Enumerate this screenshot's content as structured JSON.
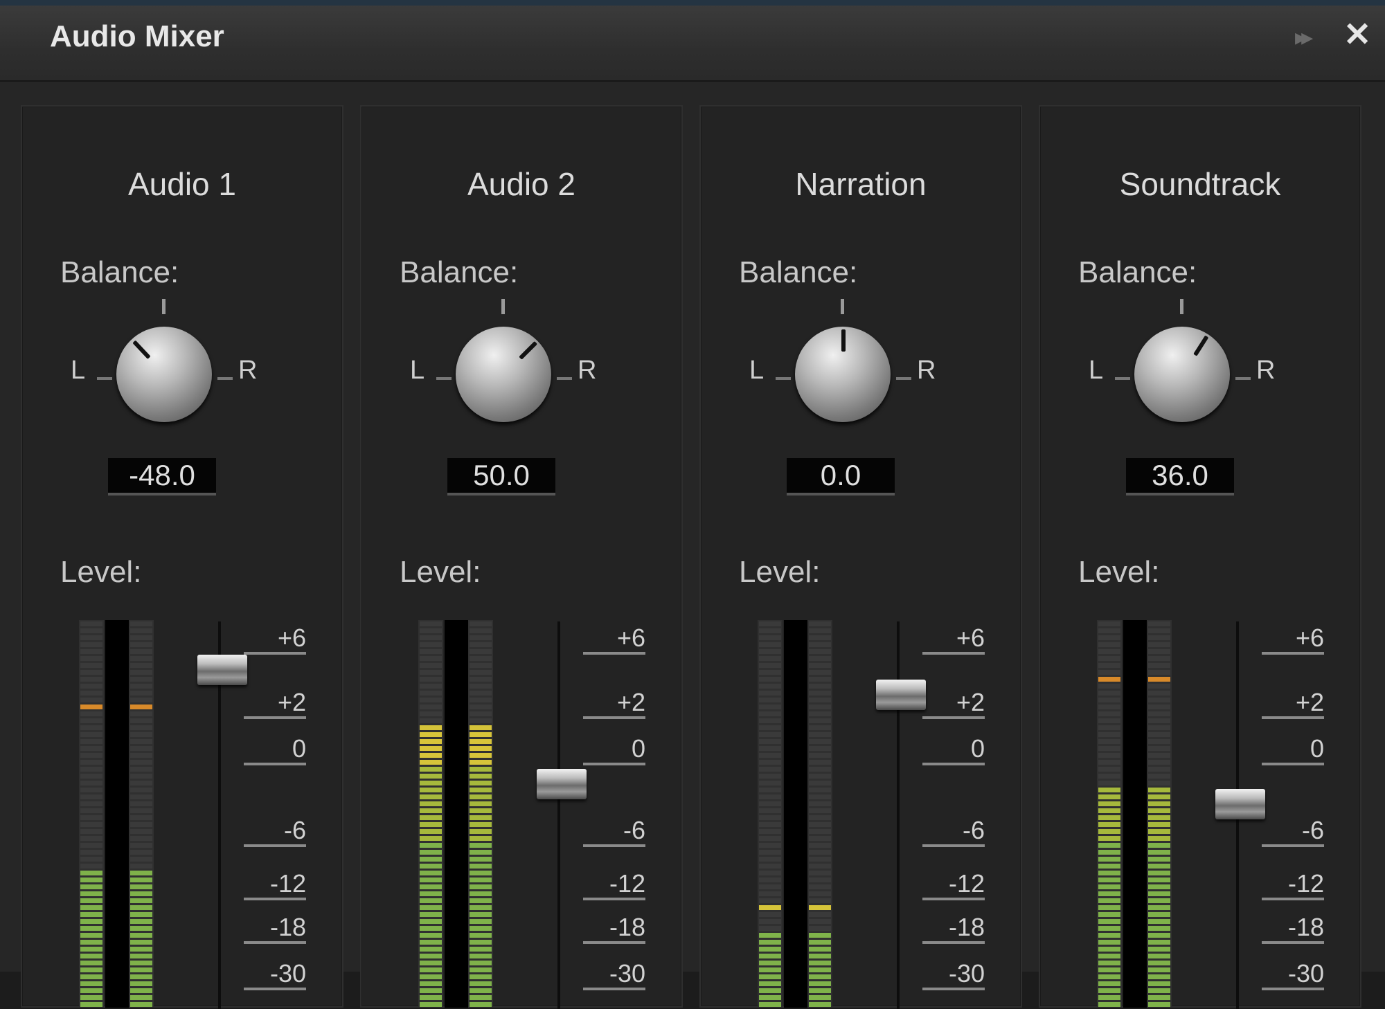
{
  "window": {
    "title": "Audio Mixer",
    "collapse_icon": "double-chevron-right-icon",
    "close_icon": "close-icon"
  },
  "labels": {
    "balance": "Balance:",
    "level": "Level:",
    "left": "L",
    "right": "R"
  },
  "scale_ticks": [
    "+6",
    "+2",
    "0",
    "-6",
    "-12",
    "-18",
    "-30"
  ],
  "colors": {
    "meter_green": "#7fb24a",
    "meter_yellow": "#d6c43a",
    "meter_orange": "#d88a2a",
    "meter_off": "#3a3a3a"
  },
  "channels": [
    {
      "name": "Audio 1",
      "balance": -48.0,
      "balance_text": "-48.0",
      "fader_db": 2.8,
      "meter_level": 0.35,
      "meter_peak": 0.78
    },
    {
      "name": "Audio 2",
      "balance": 50.0,
      "balance_text": "50.0",
      "fader_db": -4.0,
      "meter_level": 0.74,
      "meter_peak": 0.74
    },
    {
      "name": "Narration",
      "balance": 0.0,
      "balance_text": "0.0",
      "fader_db": 1.5,
      "meter_level": 0.19,
      "meter_peak": 0.27
    },
    {
      "name": "Soundtrack",
      "balance": 36.0,
      "balance_text": "36.0",
      "fader_db": -5.5,
      "meter_level": 0.57,
      "meter_peak": 0.85
    }
  ]
}
